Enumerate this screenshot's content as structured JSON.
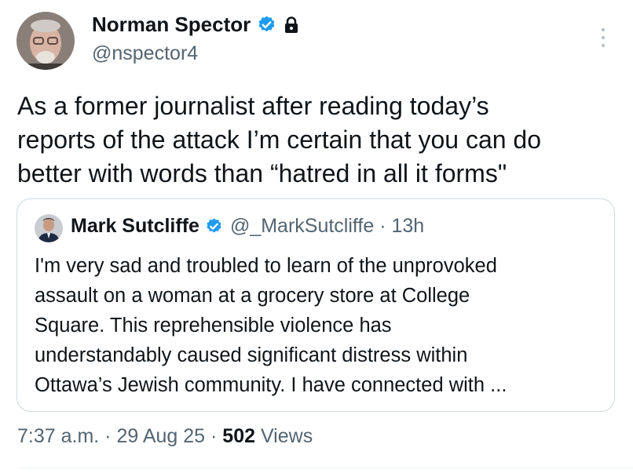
{
  "author": {
    "name": "Norman Spector",
    "handle": "@nspector4",
    "verified_icon": "verified-badge-icon",
    "protected_icon": "lock-icon"
  },
  "tweet": {
    "lines": [
      "As a former journalist after reading today’s",
      "reports of the attack I’m certain that you can do",
      "better with words than “hatred in all it forms\""
    ]
  },
  "quote": {
    "name": "Mark Sutcliffe",
    "handle": "@_MarkSutcliffe",
    "separator": " · ",
    "time": "13h",
    "lines": [
      "I'm very sad and troubled to learn of the unprovoked",
      "assault on a woman at a grocery store at College",
      "Square. This reprehensible violence has",
      "understandably caused significant distress within",
      "Ottawa’s Jewish community. I have connected with ..."
    ]
  },
  "footer": {
    "time": "7:37 a.m.",
    "sep1": " · ",
    "date": "29 Aug 25",
    "sep2": " · ",
    "views_count": "502",
    "views_label": " Views"
  },
  "colors": {
    "text": "#0f1419",
    "secondary": "#536471",
    "verified": "#1d9bf0",
    "border": "#cfd9de"
  }
}
